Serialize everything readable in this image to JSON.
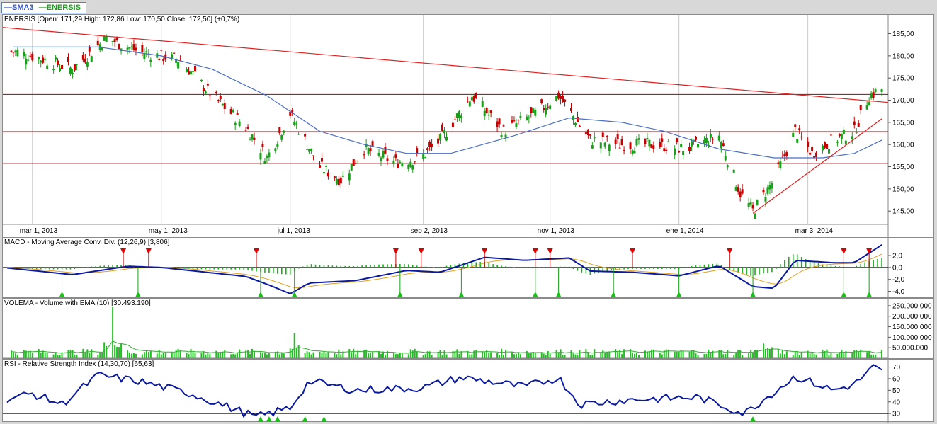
{
  "legend": {
    "items": [
      {
        "label": "SMA3",
        "color": "#3050c8"
      },
      {
        "label": "ENERSIS",
        "color": "#18a018"
      }
    ]
  },
  "price_panel": {
    "title": "ENERSIS [Open: 171,29  High: 172,86  Low: 170,50  Close: 172,50] (+0,7%)",
    "y_ticks": [
      "185,00",
      "180,00",
      "175,00",
      "170,00",
      "165,00",
      "160,00",
      "155,00",
      "150,00",
      "145,00"
    ],
    "x_ticks": [
      "mar 1, 2013",
      "may 1, 2013",
      "jul 1, 2013",
      "sep 2, 2013",
      "nov 1, 2013",
      "ene 1, 2014",
      "mar 3, 2014"
    ]
  },
  "macd_panel": {
    "title": "MACD - Moving Average Conv. Div. (12,26,9) [3,806]",
    "y_ticks": [
      "2,0",
      "0,0",
      "-2,0",
      "-4,0"
    ]
  },
  "volume_panel": {
    "title": "VOLEMA - Volume with EMA (10) [30.493.190]",
    "y_ticks": [
      "250.000.000",
      "200.000.000",
      "150.000.000",
      "100.000.000",
      "50.000.000"
    ]
  },
  "rsi_panel": {
    "title": "RSI - Relative Strength Index (14,30,70) [65,63]",
    "y_ticks": [
      "70",
      "60",
      "50",
      "40",
      "30"
    ]
  },
  "chart_data": [
    {
      "type": "candlestick",
      "title": "ENERSIS",
      "series": [
        {
          "name": "ENERSIS"
        },
        {
          "name": "SMA3"
        }
      ],
      "ylim": [
        142,
        187
      ],
      "x_range": [
        "2013-02-15",
        "2014-04-10"
      ],
      "last": {
        "open": 171.29,
        "high": 172.86,
        "low": 170.5,
        "close": 172.5,
        "change_pct": 0.7
      },
      "close_path": [
        [
          "2013-02-20",
          181
        ],
        [
          "2013-03-01",
          180
        ],
        [
          "2013-03-20",
          177
        ],
        [
          "2013-04-05",
          184
        ],
        [
          "2013-04-20",
          181
        ],
        [
          "2013-05-10",
          179
        ],
        [
          "2013-05-25",
          171
        ],
        [
          "2013-06-10",
          164
        ],
        [
          "2013-06-20",
          157
        ],
        [
          "2013-07-01",
          167
        ],
        [
          "2013-07-15",
          155
        ],
        [
          "2013-07-25",
          152
        ],
        [
          "2013-08-05",
          159
        ],
        [
          "2013-08-20",
          156
        ],
        [
          "2013-09-01",
          157
        ],
        [
          "2013-09-10",
          161
        ],
        [
          "2013-09-25",
          171
        ],
        [
          "2013-10-10",
          163
        ],
        [
          "2013-10-25",
          167
        ],
        [
          "2013-11-05",
          171
        ],
        [
          "2013-11-20",
          161
        ],
        [
          "2013-12-05",
          160
        ],
        [
          "2013-12-20",
          160
        ],
        [
          "2014-01-05",
          159
        ],
        [
          "2014-01-20",
          162
        ],
        [
          "2014-01-30",
          149
        ],
        [
          "2014-02-05",
          145
        ],
        [
          "2014-02-15",
          152
        ],
        [
          "2014-02-25",
          163
        ],
        [
          "2014-03-05",
          158
        ],
        [
          "2014-03-15",
          161
        ],
        [
          "2014-03-25",
          163
        ],
        [
          "2014-04-01",
          171
        ],
        [
          "2014-04-07",
          172.5
        ]
      ],
      "sma_path": [
        [
          "2013-02-20",
          182
        ],
        [
          "2013-04-01",
          182
        ],
        [
          "2013-05-01",
          180
        ],
        [
          "2013-05-25",
          177
        ],
        [
          "2013-06-20",
          171
        ],
        [
          "2013-07-15",
          163
        ],
        [
          "2013-08-05",
          160
        ],
        [
          "2013-08-25",
          158
        ],
        [
          "2013-09-15",
          158
        ],
        [
          "2013-10-15",
          162
        ],
        [
          "2013-11-10",
          166
        ],
        [
          "2013-12-05",
          165
        ],
        [
          "2013-12-25",
          163
        ],
        [
          "2014-01-20",
          159
        ],
        [
          "2014-02-15",
          157
        ],
        [
          "2014-03-10",
          157
        ],
        [
          "2014-03-25",
          158
        ],
        [
          "2014-04-07",
          161
        ]
      ],
      "horizontal_lines": [
        171.3,
        162.9,
        155.7
      ],
      "trendlines": [
        {
          "from": [
            "2013-02-15",
            186.4
          ],
          "to": [
            "2014-04-10",
            169.5
          ]
        },
        {
          "from": [
            "2014-02-05",
            144.5
          ],
          "to": [
            "2014-04-07",
            165.8
          ]
        }
      ]
    },
    {
      "type": "line",
      "title": "MACD - Moving Average Conv. Div. (12,26,9)",
      "last_value": 3.806,
      "ylim": [
        -5,
        4.5
      ],
      "macd_path": [
        [
          "2013-02-15",
          0
        ],
        [
          "2013-03-20",
          -1.2
        ],
        [
          "2013-04-15",
          0.2
        ],
        [
          "2013-05-01",
          0
        ],
        [
          "2013-06-10",
          -1.5
        ],
        [
          "2013-06-20",
          -2.8
        ],
        [
          "2013-07-01",
          -4.4
        ],
        [
          "2013-07-10",
          -2.6
        ],
        [
          "2013-08-01",
          -2.2
        ],
        [
          "2013-08-25",
          -0.5
        ],
        [
          "2013-09-10",
          -0.8
        ],
        [
          "2013-10-01",
          1.7
        ],
        [
          "2013-10-20",
          1.2
        ],
        [
          "2013-11-10",
          1.6
        ],
        [
          "2013-11-20",
          -0.6
        ],
        [
          "2013-12-10",
          -0.8
        ],
        [
          "2014-01-01",
          -1.4
        ],
        [
          "2014-01-20",
          0.3
        ],
        [
          "2014-02-05",
          -3.2
        ],
        [
          "2014-02-15",
          -3.5
        ],
        [
          "2014-02-25",
          1.2
        ],
        [
          "2014-03-15",
          0.8
        ],
        [
          "2014-03-25",
          0.8
        ],
        [
          "2014-04-07",
          3.8
        ]
      ],
      "buy_signals": [
        "2013-03-15",
        "2013-04-20",
        "2013-06-17",
        "2013-07-03",
        "2013-08-22",
        "2013-09-20",
        "2013-10-25",
        "2013-11-05",
        "2013-12-01",
        "2014-01-01",
        "2014-02-05",
        "2014-03-20",
        "2014-04-01"
      ],
      "sell_signals": [
        "2013-04-13",
        "2013-04-25",
        "2013-06-15",
        "2013-08-20",
        "2013-09-01",
        "2013-10-01",
        "2013-10-25",
        "2013-11-01",
        "2013-12-10",
        "2014-01-25",
        "2014-03-20",
        "2014-04-01"
      ]
    },
    {
      "type": "bar",
      "title": "VOLEMA - Volume with EMA (10)",
      "last_value": 30493190,
      "ylim": [
        0,
        270000000
      ],
      "peaks": [
        [
          "2013-04-08",
          260000000
        ],
        [
          "2013-07-03",
          120000000
        ],
        [
          "2014-02-10",
          70000000
        ]
      ],
      "typical": 30000000
    },
    {
      "type": "line",
      "title": "RSI - Relative Strength Index (14,30,70)",
      "last_value": 65.63,
      "ylim": [
        24,
        74
      ],
      "reference_lines": [
        70,
        30
      ],
      "path": [
        [
          "2013-02-15",
          42
        ],
        [
          "2013-03-01",
          47
        ],
        [
          "2013-03-15",
          38
        ],
        [
          "2013-04-01",
          63
        ],
        [
          "2013-04-20",
          58
        ],
        [
          "2013-05-15",
          47
        ],
        [
          "2013-06-15",
          27
        ],
        [
          "2013-07-01",
          35
        ],
        [
          "2013-07-10",
          58
        ],
        [
          "2013-08-01",
          50
        ],
        [
          "2013-09-01",
          52
        ],
        [
          "2013-09-20",
          61
        ],
        [
          "2013-10-20",
          53
        ],
        [
          "2013-11-05",
          61
        ],
        [
          "2013-11-15",
          38
        ],
        [
          "2013-12-10",
          42
        ],
        [
          "2014-01-10",
          44
        ],
        [
          "2014-02-01",
          30
        ],
        [
          "2014-02-10",
          42
        ],
        [
          "2014-02-25",
          62
        ],
        [
          "2014-03-15",
          50
        ],
        [
          "2014-03-25",
          55
        ],
        [
          "2014-04-03",
          70
        ],
        [
          "2014-04-07",
          65.6
        ]
      ],
      "oversold_signals": [
        "2013-06-17",
        "2013-06-21",
        "2013-06-25",
        "2013-07-08",
        "2013-07-17",
        "2014-02-05"
      ]
    }
  ]
}
